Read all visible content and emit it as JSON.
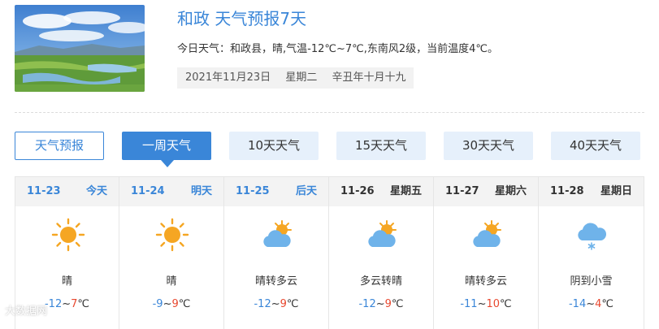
{
  "header": {
    "title": "和政 天气预报7天",
    "today_summary": "今日天气：和政县，晴,气温-12℃~7℃,东南风2级，当前温度4℃。",
    "date": "2021年11月23日",
    "weekday": "星期二",
    "lunar": "辛丑年十月十九"
  },
  "tabs": [
    {
      "label": "天气预报"
    },
    {
      "label": "一周天气"
    },
    {
      "label": "10天天气"
    },
    {
      "label": "15天天气"
    },
    {
      "label": "30天天气"
    },
    {
      "label": "40天天气"
    }
  ],
  "forecast": [
    {
      "date": "11-23",
      "day": "今天",
      "icon": "sun-icon",
      "condition": "晴",
      "low": "-12",
      "high": "7",
      "unit": "℃",
      "sep": "~"
    },
    {
      "date": "11-24",
      "day": "明天",
      "icon": "sun-icon",
      "condition": "晴",
      "low": "-9",
      "high": "9",
      "unit": "℃",
      "sep": "~"
    },
    {
      "date": "11-25",
      "day": "后天",
      "icon": "partly-cloudy-icon",
      "condition": "晴转多云",
      "low": "-12",
      "high": "9",
      "unit": "℃",
      "sep": "~"
    },
    {
      "date": "11-26",
      "day": "星期五",
      "icon": "partly-cloudy-icon",
      "condition": "多云转晴",
      "low": "-12",
      "high": "9",
      "unit": "℃",
      "sep": "~"
    },
    {
      "date": "11-27",
      "day": "星期六",
      "icon": "partly-cloudy-icon",
      "condition": "晴转多云",
      "low": "-11",
      "high": "10",
      "unit": "℃",
      "sep": "~"
    },
    {
      "date": "11-28",
      "day": "星期日",
      "icon": "snow-cloud-icon",
      "condition": "阴到小雪",
      "low": "-14",
      "high": "4",
      "unit": "℃",
      "sep": "~"
    }
  ],
  "watermark": "大数据网",
  "colors": {
    "accent": "#3a86d8",
    "low": "#3a86d8",
    "high": "#e8482f",
    "sun": "#f5a623",
    "cloud": "#6fb3ea"
  }
}
